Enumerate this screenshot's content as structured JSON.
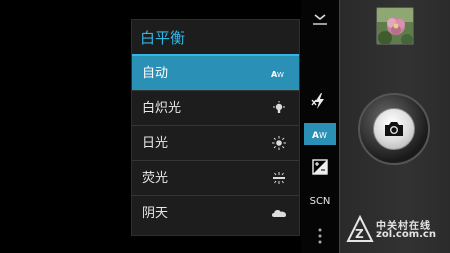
{
  "white_balance_menu": {
    "title": "白平衡",
    "options": [
      {
        "label": "自动",
        "icon": "auto-wb-icon",
        "selected": true
      },
      {
        "label": "白炽光",
        "icon": "incandescent-bulb-icon",
        "selected": false
      },
      {
        "label": "日光",
        "icon": "daylight-sun-icon",
        "selected": false
      },
      {
        "label": "荧光",
        "icon": "fluorescent-icon",
        "selected": false
      },
      {
        "label": "阴天",
        "icon": "cloudy-icon",
        "selected": false
      }
    ]
  },
  "control_strip": {
    "items": [
      {
        "name": "collapse-chevron-icon"
      },
      {
        "name": "flash-off-icon"
      },
      {
        "name": "white-balance-auto-icon",
        "active": true
      },
      {
        "name": "exposure-icon"
      },
      {
        "name": "scene-mode",
        "label": "SCN"
      },
      {
        "name": "more-options-icon"
      }
    ]
  },
  "watermark": {
    "text_cn": "中关村在线",
    "text_url": "zol.com.cn"
  },
  "colors": {
    "accent": "#33b5e5",
    "selected_bg": "#2a90b6"
  }
}
